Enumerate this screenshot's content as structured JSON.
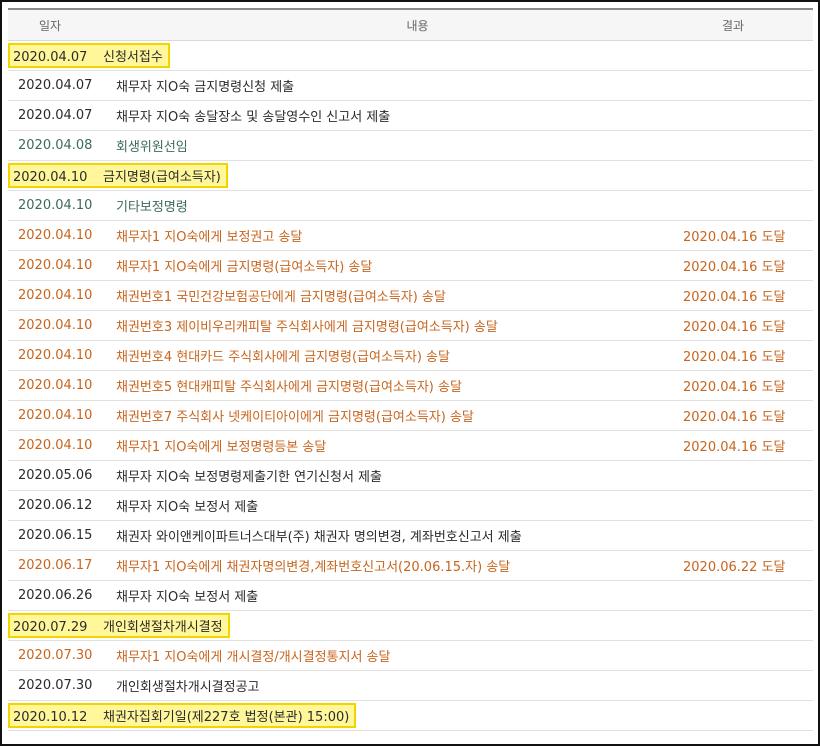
{
  "table": {
    "headers": {
      "date": "일자",
      "content": "내용",
      "result": "결과"
    },
    "rows": [
      {
        "date": "2020.04.07",
        "content": "신청서접수",
        "result": "",
        "tone": "dark",
        "highlight": true
      },
      {
        "date": "2020.04.07",
        "content": "채무자 지O숙 금지명령신청 제출",
        "result": "",
        "tone": "dark",
        "highlight": false
      },
      {
        "date": "2020.04.07",
        "content": "채무자 지O숙 송달장소 및 송달영수인 신고서 제출",
        "result": "",
        "tone": "dark",
        "highlight": false
      },
      {
        "date": "2020.04.08",
        "content": "회생위원선임",
        "result": "",
        "tone": "teal",
        "highlight": false
      },
      {
        "date": "2020.04.10",
        "content": "금지명령(급여소득자)",
        "result": "",
        "tone": "teal",
        "highlight": true
      },
      {
        "date": "2020.04.10",
        "content": "기타보정명령",
        "result": "",
        "tone": "teal",
        "highlight": false
      },
      {
        "date": "2020.04.10",
        "content": "채무자1 지O숙에게 보정권고 송달",
        "result": "2020.04.16 도달",
        "tone": "orange",
        "highlight": false
      },
      {
        "date": "2020.04.10",
        "content": "채무자1 지O숙에게 금지명령(급여소득자) 송달",
        "result": "2020.04.16 도달",
        "tone": "orange",
        "highlight": false
      },
      {
        "date": "2020.04.10",
        "content": "채권번호1 국민건강보험공단에게 금지명령(급여소득자) 송달",
        "result": "2020.04.16 도달",
        "tone": "orange",
        "highlight": false
      },
      {
        "date": "2020.04.10",
        "content": "채권번호3 제이비우리캐피탈 주식회사에게 금지명령(급여소득자) 송달",
        "result": "2020.04.16 도달",
        "tone": "orange",
        "highlight": false
      },
      {
        "date": "2020.04.10",
        "content": "채권번호4 현대카드 주식회사에게 금지명령(급여소득자) 송달",
        "result": "2020.04.16 도달",
        "tone": "orange",
        "highlight": false
      },
      {
        "date": "2020.04.10",
        "content": "채권번호5 현대캐피탈 주식회사에게 금지명령(급여소득자) 송달",
        "result": "2020.04.16 도달",
        "tone": "orange",
        "highlight": false
      },
      {
        "date": "2020.04.10",
        "content": "채권번호7 주식회사 넷케이티아이에게 금지명령(급여소득자) 송달",
        "result": "2020.04.16 도달",
        "tone": "orange",
        "highlight": false
      },
      {
        "date": "2020.04.10",
        "content": "채무자1 지O숙에게 보정명령등본 송달",
        "result": "2020.04.16 도달",
        "tone": "orange",
        "highlight": false
      },
      {
        "date": "2020.05.06",
        "content": "채무자 지O숙 보정명령제출기한 연기신청서 제출",
        "result": "",
        "tone": "dark",
        "highlight": false
      },
      {
        "date": "2020.06.12",
        "content": "채무자 지O숙 보정서 제출",
        "result": "",
        "tone": "dark",
        "highlight": false
      },
      {
        "date": "2020.06.15",
        "content": "채권자 와이앤케이파트너스대부(주) 채권자 명의변경, 계좌번호신고서 제출",
        "result": "",
        "tone": "dark",
        "highlight": false
      },
      {
        "date": "2020.06.17",
        "content": "채무자1 지O숙에게 채권자명의변경,계좌번호신고서(20.06.15.자) 송달",
        "result": "2020.06.22 도달",
        "tone": "orange",
        "highlight": false
      },
      {
        "date": "2020.06.26",
        "content": "채무자 지O숙 보정서 제출",
        "result": "",
        "tone": "dark",
        "highlight": false
      },
      {
        "date": "2020.07.29",
        "content": "개인회생절차개시결정",
        "result": "",
        "tone": "teal",
        "highlight": true
      },
      {
        "date": "2020.07.30",
        "content": "채무자1 지O숙에게 개시결정/개시결정통지서 송달",
        "result": "",
        "tone": "orange",
        "highlight": false
      },
      {
        "date": "2020.07.30",
        "content": "개인회생절차개시결정공고",
        "result": "",
        "tone": "dark",
        "highlight": false
      },
      {
        "date": "2020.10.12",
        "content": "채권자집회기일(제227호 법정(본관) 15:00)",
        "result": "",
        "tone": "dark",
        "highlight": true
      }
    ]
  },
  "colors": {
    "dark": "#2b2b2b",
    "teal": "#3e6b57",
    "orange": "#c8651e",
    "highlight_fill": "#fff79a",
    "highlight_border": "#f2d400"
  }
}
